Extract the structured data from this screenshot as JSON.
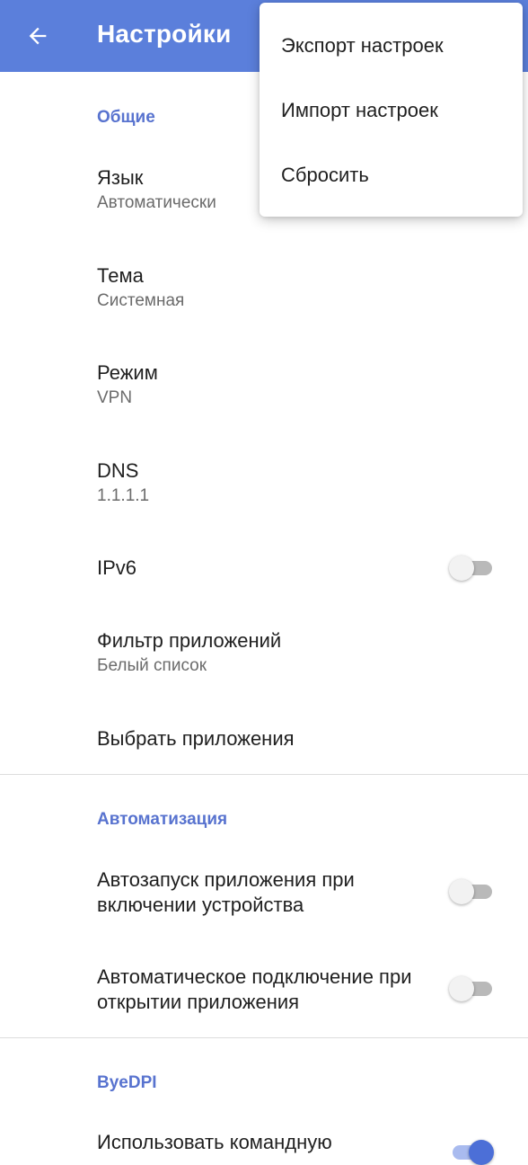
{
  "appbar": {
    "title": "Настройки",
    "back_icon": "arrow-left-icon",
    "background_color": "#5b7fdb"
  },
  "menu": {
    "items": [
      "Экспорт настроек",
      "Импорт настроек",
      "Сбросить"
    ]
  },
  "sections": {
    "general": {
      "header": "Общие",
      "language": {
        "title": "Язык",
        "summary": "Автоматически"
      },
      "theme": {
        "title": "Тема",
        "summary": "Системная"
      },
      "mode": {
        "title": "Режим",
        "summary": "VPN"
      },
      "dns": {
        "title": "DNS",
        "summary": "1.1.1.1"
      },
      "ipv6": {
        "title": "IPv6",
        "enabled": false
      },
      "app_filter": {
        "title": "Фильтр приложений",
        "summary": "Белый список"
      },
      "select_apps": {
        "title": "Выбрать приложения"
      }
    },
    "automation": {
      "header": "Автоматизация",
      "autostart": {
        "title": "Автозапуск приложения при включении устройства",
        "enabled": false
      },
      "autoconnect": {
        "title": "Автоматическое подключение при открытии приложения",
        "enabled": false
      }
    },
    "byedpi": {
      "header": "ByeDPI",
      "cmdline": {
        "title": "Использовать командную",
        "enabled": true
      }
    }
  },
  "colors": {
    "accent": "#5873cf",
    "switch_on": "#4c6fd7"
  }
}
